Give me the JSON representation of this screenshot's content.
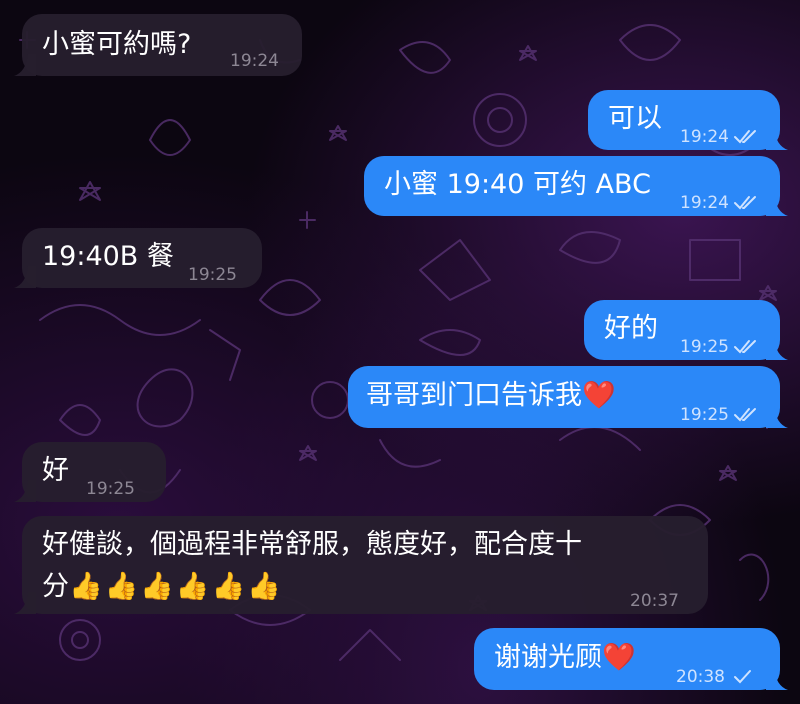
{
  "messages": [
    {
      "dir": "in",
      "text": "小蜜可約嗎?",
      "time": "19:24"
    },
    {
      "dir": "out",
      "text": "可以",
      "time": "19:24",
      "status": "read"
    },
    {
      "dir": "out",
      "text": "小蜜 19:40 可约 ABC",
      "time": "19:24",
      "status": "read"
    },
    {
      "dir": "in",
      "text": "19:40B 餐",
      "time": "19:25"
    },
    {
      "dir": "out",
      "text": "好的",
      "time": "19:25",
      "status": "read"
    },
    {
      "dir": "out",
      "text": "哥哥到门口告诉我",
      "emoji": "❤️",
      "time": "19:25",
      "status": "read"
    },
    {
      "dir": "in",
      "text": "好",
      "time": "19:25"
    },
    {
      "dir": "in",
      "text_line1": "好健談，個過程非常舒服，態度好，配合度十",
      "text_line2": "分",
      "emoji": "👍👍👍👍👍👍",
      "time": "20:37"
    },
    {
      "dir": "out",
      "text": "谢谢光顾",
      "emoji": "❤️",
      "time": "20:38",
      "status": "delivered"
    }
  ],
  "colors": {
    "incoming_bubble": "#261e2e",
    "outgoing_bubble": "#2b88f8",
    "background": "#0c0611",
    "doodle": "#5a2f78"
  }
}
